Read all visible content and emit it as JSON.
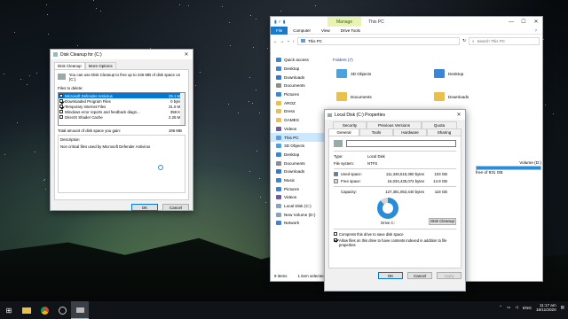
{
  "cleanup": {
    "title": "Disk Cleanup for (C:)",
    "tabs": [
      "Disk Cleanup",
      "More Options"
    ],
    "intro": "You can use Disk Cleanup to free up to 246 MB of disk space on (C:).",
    "files_label": "Files to delete:",
    "items": [
      {
        "name": "Microsoft Defender Antivirus",
        "size": "29.1 MB",
        "checked": false,
        "selected": true
      },
      {
        "name": "Downloaded Program Files",
        "size": "0 bytes",
        "checked": true,
        "selected": false
      },
      {
        "name": "Temporary Internet Files",
        "size": "31.6 MB",
        "checked": true,
        "selected": false
      },
      {
        "name": "Windows error reports and feedback diagn...",
        "size": "358 KB",
        "checked": false,
        "selected": false
      },
      {
        "name": "DirectX Shader Cache",
        "size": "2.25 MB",
        "checked": false,
        "selected": false
      }
    ],
    "total_label": "Total amount of disk space you gain:",
    "total_value": "196 MB",
    "desc_label": "Description",
    "desc_text": "Non critical files used by Microsoft Defender Antivirus",
    "ok": "OK",
    "cancel": "Cancel"
  },
  "explorer": {
    "title": "This PC",
    "manage": "Manage",
    "ribbon": [
      "File",
      "Computer",
      "View",
      "Drive Tools"
    ],
    "address": "This PC",
    "search_placeholder": "Search This PC",
    "nav": [
      {
        "label": "Quick access",
        "color": "#3a86d6"
      },
      {
        "label": "Desktop",
        "color": "#3a86d6"
      },
      {
        "label": "Downloads",
        "color": "#2c7bd1"
      },
      {
        "label": "Documents",
        "color": "#8c8c8c"
      },
      {
        "label": "Pictures",
        "color": "#3a86d6"
      },
      {
        "label": "AROZ",
        "color": "#e8c04a"
      },
      {
        "label": "Dress",
        "color": "#e8c04a"
      },
      {
        "label": "GAMES",
        "color": "#e8c04a"
      },
      {
        "label": "Videos",
        "color": "#6b5ca5"
      },
      {
        "label": "This PC",
        "color": "#5aa0e0"
      },
      {
        "label": "3D Objects",
        "color": "#4aa3df"
      },
      {
        "label": "Desktop",
        "color": "#3a86d6"
      },
      {
        "label": "Documents",
        "color": "#8c8c8c"
      },
      {
        "label": "Downloads",
        "color": "#2c7bd1"
      },
      {
        "label": "Music",
        "color": "#3a86d6"
      },
      {
        "label": "Pictures",
        "color": "#3a86d6"
      },
      {
        "label": "Videos",
        "color": "#6b5ca5"
      },
      {
        "label": "Local Disk (C:)",
        "color": "#8aa3b8"
      },
      {
        "label": "New Volume (D:)",
        "color": "#8aa3b8"
      },
      {
        "label": "Network",
        "color": "#3a86d6"
      }
    ],
    "group": "Folders (7)",
    "folders": [
      "3D Objects",
      "Desktop",
      "Documents",
      "Downloads"
    ],
    "drive_d": "Volume (D:)",
    "drive_d_free": "free of 931 GB",
    "status_items": "9 items",
    "status_selected": "1 item selected"
  },
  "props": {
    "title": "Local Disk (C:) Properties",
    "tabs_top": [
      "Security",
      "Previous Versions",
      "Quota"
    ],
    "tabs_bottom": [
      "General",
      "Tools",
      "Hardware",
      "Sharing"
    ],
    "type_label": "Type:",
    "type_value": "Local Disk",
    "fs_label": "File system:",
    "fs_value": "NTFS",
    "used_label": "Used space:",
    "used_bytes": "111,346,615,360 bytes",
    "used_gb": "103 GB",
    "free_label": "Free space:",
    "free_bytes": "16,034,435,072 bytes",
    "free_gb": "14.9 GB",
    "cap_label": "Capacity:",
    "cap_bytes": "127,381,053,440 bytes",
    "cap_gb": "118 GB",
    "drive_label": "Drive C:",
    "cleanup_btn": "Disk Cleanup",
    "compress": "Compress this drive to save disk space",
    "index": "Allow files on this drive to have contents indexed in addition to file properties",
    "ok": "OK",
    "cancel": "Cancel",
    "apply": "Apply",
    "used_color": "#2a8bd8",
    "free_color": "#d6d6d6"
  },
  "taskbar": {
    "time": "11:17 am",
    "date": "18/11/2020",
    "lang": "ENG"
  }
}
